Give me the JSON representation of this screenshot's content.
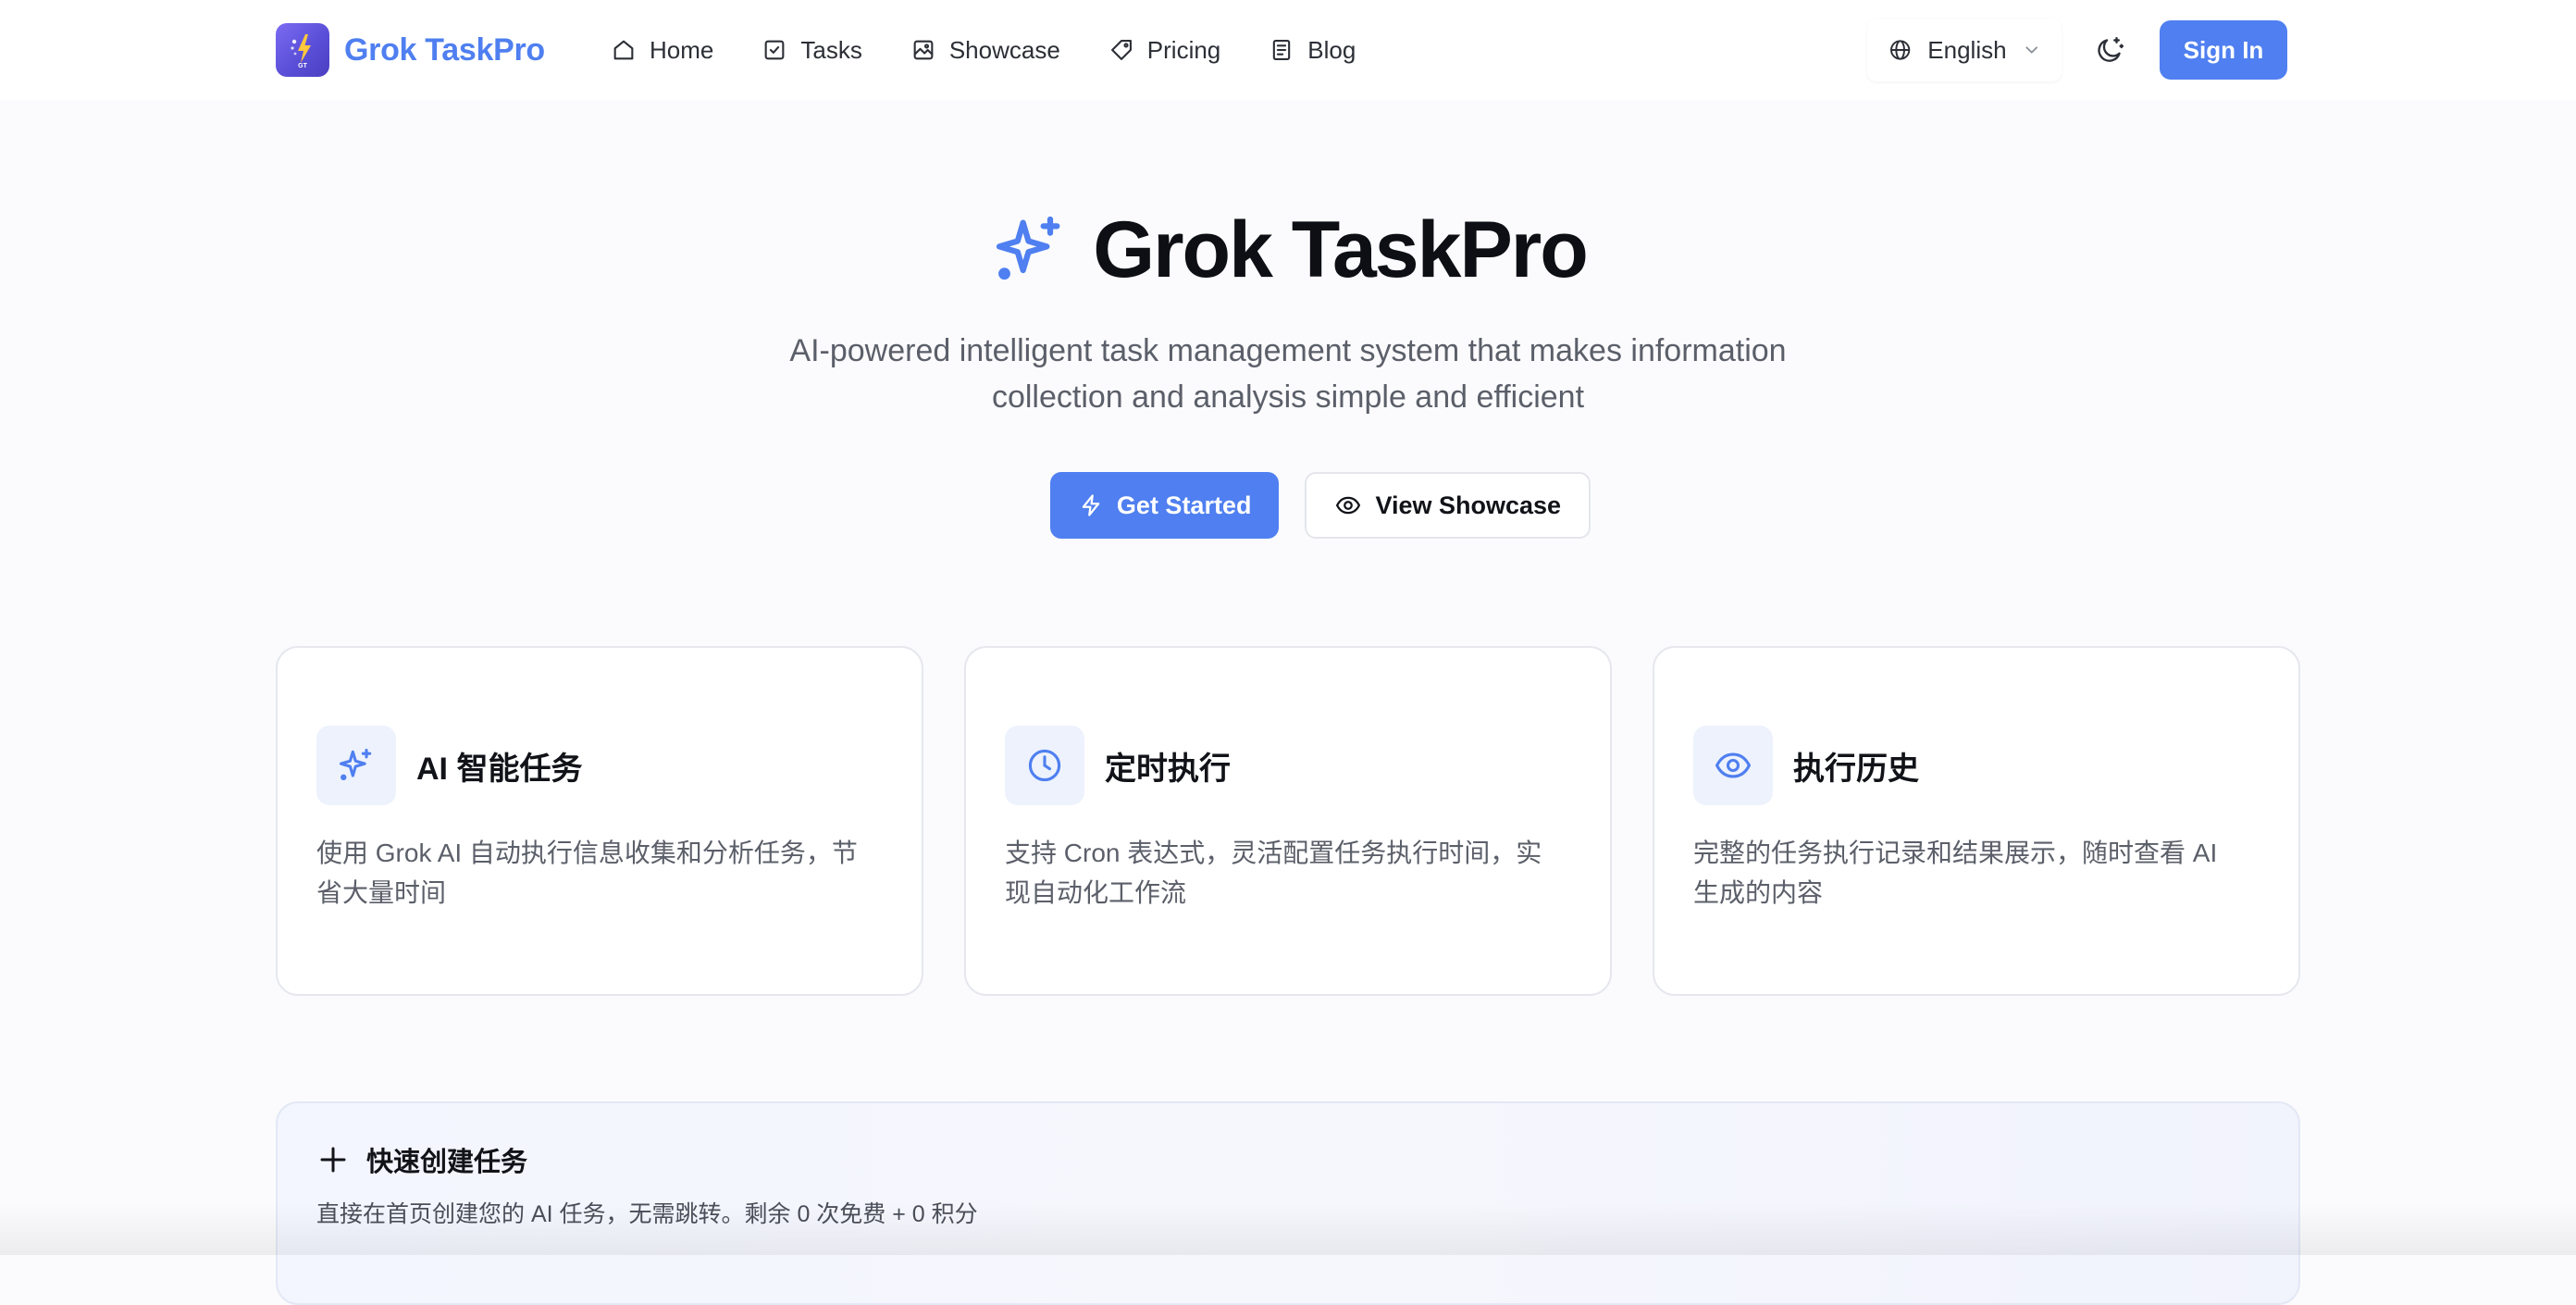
{
  "brand": {
    "name": "Grok TaskPro",
    "logo_text": "GT",
    "logo_icon": "lightning-icon"
  },
  "nav": {
    "items": [
      {
        "label": "Home",
        "icon": "home-icon"
      },
      {
        "label": "Tasks",
        "icon": "checkbox-icon"
      },
      {
        "label": "Showcase",
        "icon": "gallery-icon"
      },
      {
        "label": "Pricing",
        "icon": "tag-icon"
      },
      {
        "label": "Blog",
        "icon": "document-icon"
      }
    ]
  },
  "header": {
    "language": "English",
    "language_icon": "globe-icon",
    "theme_icon": "moon-icon",
    "sign_in": "Sign In"
  },
  "hero": {
    "title": "Grok TaskPro",
    "title_icon": "sparkles-icon",
    "subtitle_line1": "AI-powered intelligent task management system that makes information",
    "subtitle_line2": "collection and analysis simple and efficient",
    "primary_cta": "Get Started",
    "secondary_cta": "View Showcase"
  },
  "features": [
    {
      "title": "AI 智能任务",
      "icon": "sparkles-icon",
      "desc_line1": "使用 Grok AI 自动执行信息收集和分析任务，节",
      "desc_line2": "省大量时间"
    },
    {
      "title": "定时执行",
      "icon": "clock-icon",
      "desc_line1": "支持 Cron 表达式，灵活配置任务执行时间，实",
      "desc_line2": "现自动化工作流"
    },
    {
      "title": "执行历史",
      "icon": "eye-icon",
      "desc_line1": "完整的任务执行记录和结果展示，随时查看 AI",
      "desc_line2": "生成的内容"
    }
  ],
  "quick_create": {
    "title": "快速创建任务",
    "icon": "plus-icon",
    "description": "直接在首页创建您的 AI 任务，无需跳转。剩余 0 次免费 + 0 积分"
  },
  "colors": {
    "accent": "#4f7ff0",
    "text": "#111318",
    "muted": "#5b5f69",
    "icon_bg": "#edf2fd",
    "logo_gradient_start": "#7c6cf2",
    "logo_gradient_end": "#4a3fc0"
  }
}
